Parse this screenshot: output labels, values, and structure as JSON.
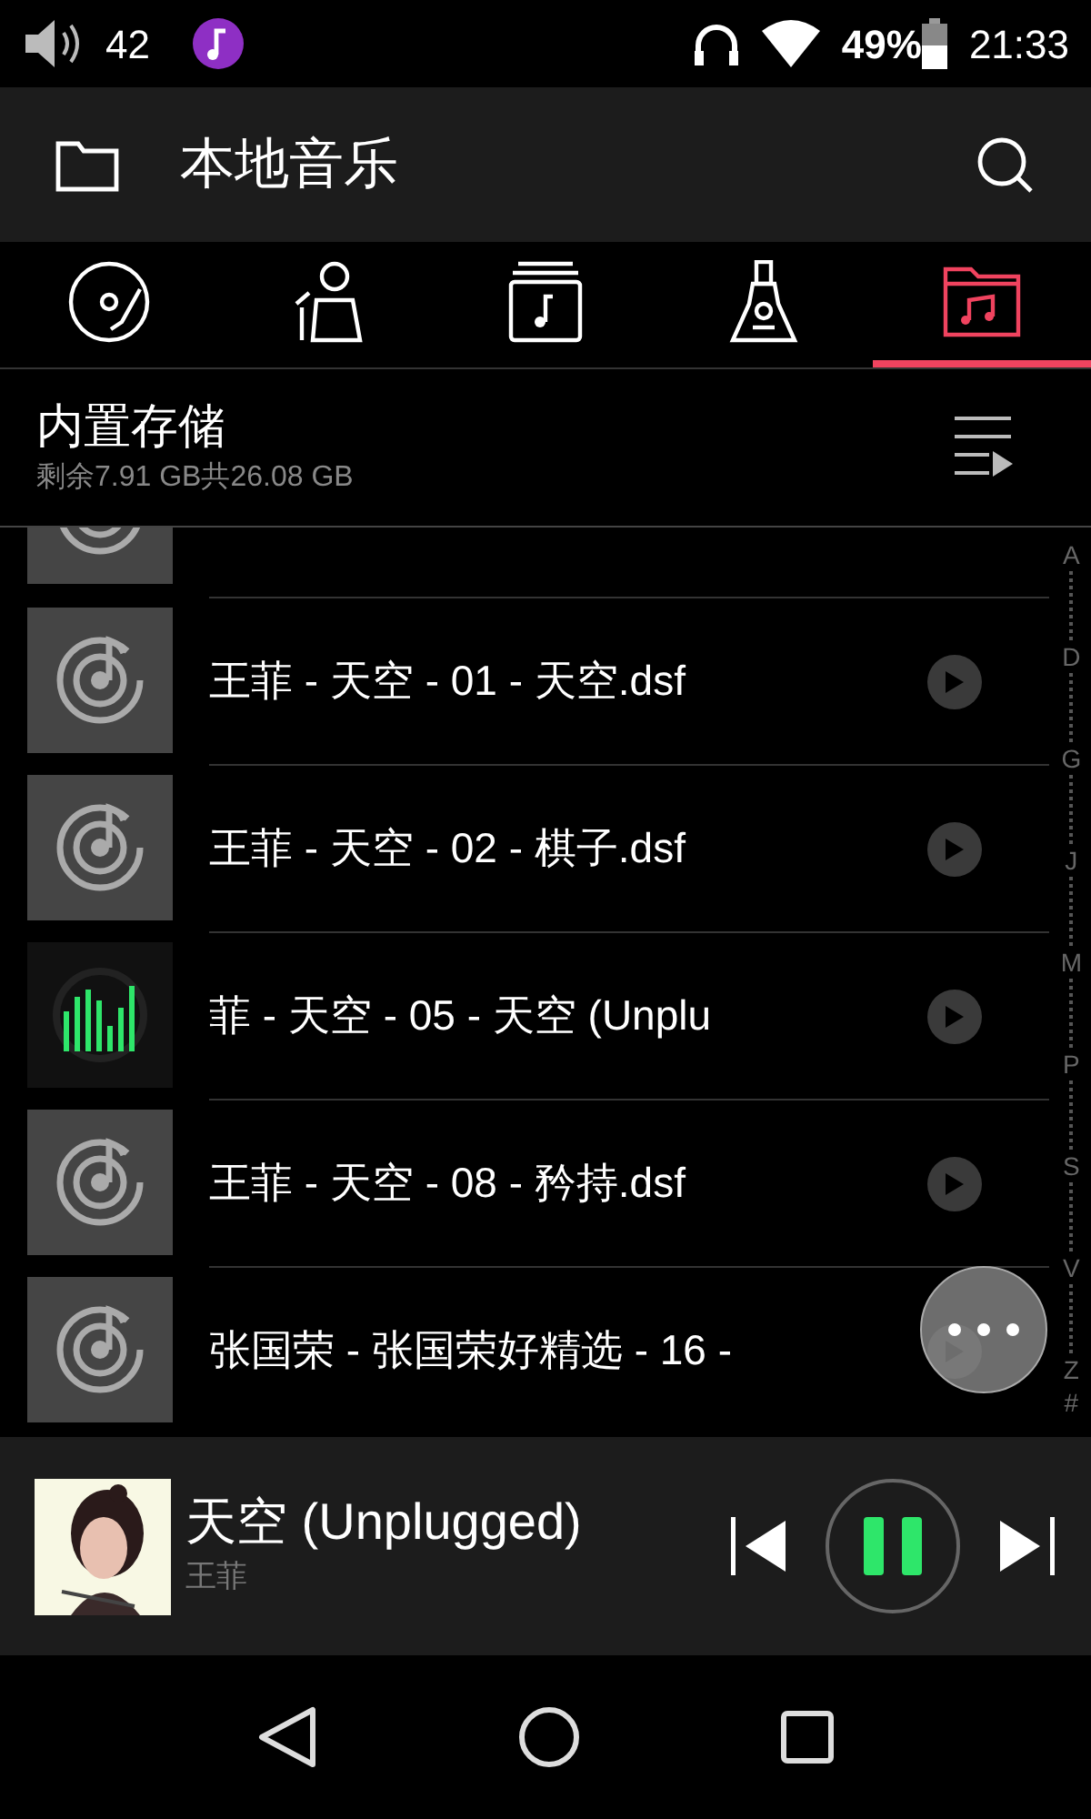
{
  "status_bar": {
    "volume": "42",
    "battery": "49%",
    "time": "21:33"
  },
  "app_bar": {
    "title": "本地音乐"
  },
  "tabs": [
    {
      "kind": "disc",
      "selected": false
    },
    {
      "kind": "artist",
      "selected": false
    },
    {
      "kind": "album",
      "selected": false
    },
    {
      "kind": "genre",
      "selected": false
    },
    {
      "kind": "folder",
      "selected": true
    }
  ],
  "storage": {
    "title": "内置存储",
    "subtitle": "剩余7.91 GB共26.08 GB"
  },
  "tracks": [
    {
      "title": "王菲 - 天空 - 01 - 天空.dsf",
      "playing": false
    },
    {
      "title": "王菲 - 天空 - 02 - 棋子.dsf",
      "playing": false
    },
    {
      "title": "菲 - 天空 - 05 - 天空 (Unplu",
      "playing": true
    },
    {
      "title": "王菲 - 天空 - 08 - 矜持.dsf",
      "playing": false
    },
    {
      "title": "张国荣 - 张国荣好精选 - 16 -",
      "playing": false
    }
  ],
  "index_letters": [
    "A",
    "D",
    "G",
    "J",
    "M",
    "P",
    "S",
    "V",
    "Z",
    "#"
  ],
  "now_playing": {
    "title": "天空 (Unplugged)",
    "artist": "王菲",
    "playing": true
  }
}
